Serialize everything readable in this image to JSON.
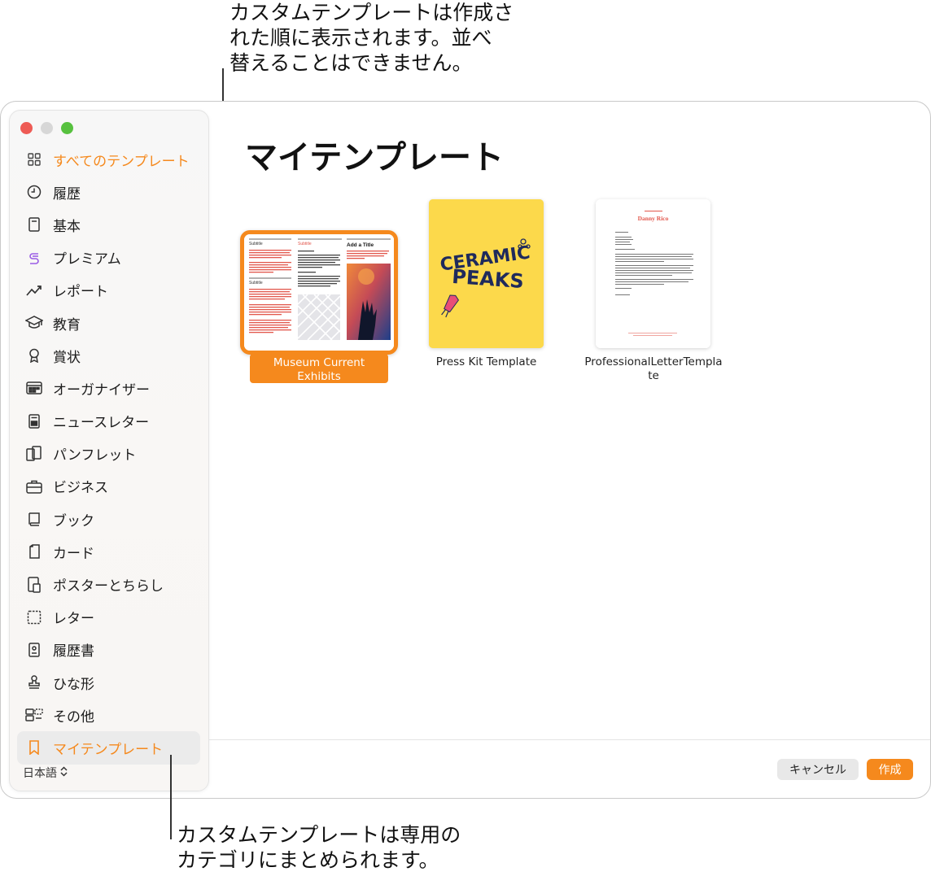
{
  "callouts": {
    "top": "カスタムテンプレートは作成さ\nれた順に表示されます。並べ\n替えることはできません。",
    "bottom": "カスタムテンプレートは専用の\nカテゴリにまとめられます。"
  },
  "sidebar": {
    "items": [
      {
        "label": "すべてのテンプレート",
        "icon": "grid-icon"
      },
      {
        "label": "履歴",
        "icon": "clock-icon"
      },
      {
        "label": "基本",
        "icon": "document-icon"
      },
      {
        "label": "プレミアム",
        "icon": "premium-icon"
      },
      {
        "label": "レポート",
        "icon": "chart-line-icon"
      },
      {
        "label": "教育",
        "icon": "graduation-cap-icon"
      },
      {
        "label": "賞状",
        "icon": "award-ribbon-icon"
      },
      {
        "label": "オーガナイザー",
        "icon": "organizer-icon"
      },
      {
        "label": "ニュースレター",
        "icon": "newsletter-icon"
      },
      {
        "label": "パンフレット",
        "icon": "brochure-icon"
      },
      {
        "label": "ビジネス",
        "icon": "briefcase-icon"
      },
      {
        "label": "ブック",
        "icon": "book-icon"
      },
      {
        "label": "カード",
        "icon": "card-icon"
      },
      {
        "label": "ポスターとちらし",
        "icon": "poster-icon"
      },
      {
        "label": "レター",
        "icon": "letter-icon"
      },
      {
        "label": "履歴書",
        "icon": "resume-icon"
      },
      {
        "label": "ひな形",
        "icon": "stamp-icon"
      },
      {
        "label": "その他",
        "icon": "misc-icon"
      },
      {
        "label": "マイテンプレート",
        "icon": "bookmark-icon"
      }
    ],
    "language": "日本語"
  },
  "main": {
    "title": "マイテンプレート",
    "templates": [
      {
        "label": "Museum Current Exhibits",
        "thumb": {
          "subtitle": "Subtitle",
          "add_title": "Add a Title"
        }
      },
      {
        "label": "Press Kit Template",
        "thumb": {
          "line1": "CERAMIC",
          "line2": "PEAKS"
        }
      },
      {
        "label": "ProfessionalLetterTempla\nte",
        "thumb": {
          "name": "Danny Rico"
        }
      }
    ]
  },
  "buttons": {
    "cancel": "キャンセル",
    "create": "作成"
  },
  "colors": {
    "accent": "#f5891d",
    "close": "#ee5b55",
    "zoom": "#57c13f"
  }
}
